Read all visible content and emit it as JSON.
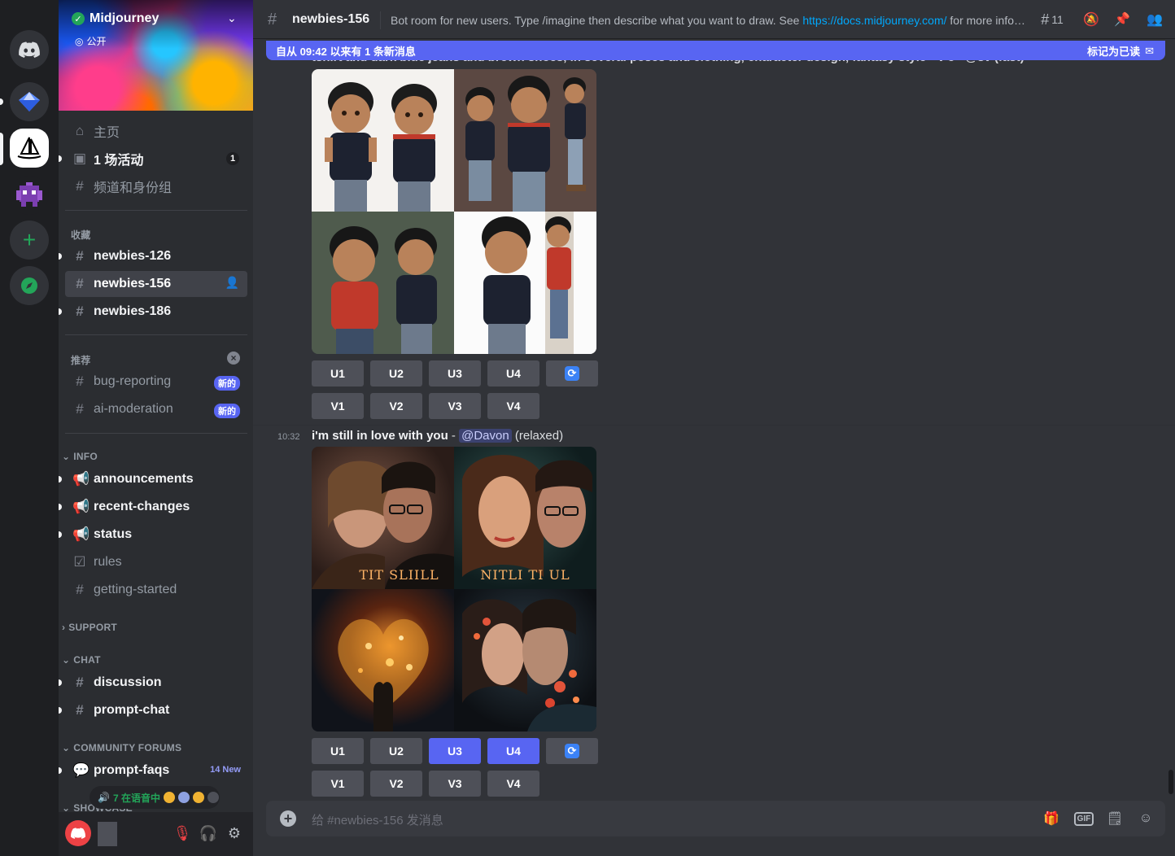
{
  "server": {
    "name": "Midjourney",
    "visibility": "公开"
  },
  "nav": {
    "home": "主页",
    "events": "1 场活动",
    "events_count": "1",
    "channels_roles": "频道和身份组"
  },
  "sections": {
    "favorites": "收藏",
    "recommended": "推荐",
    "info": "INFO",
    "support": "SUPPORT",
    "chat": "CHAT",
    "community": "COMMUNITY FORUMS",
    "showcase": "SHOWCASE"
  },
  "channels": {
    "fav": [
      "newbies-126",
      "newbies-156",
      "newbies-186"
    ],
    "rec": [
      {
        "name": "bug-reporting",
        "tag": "新的"
      },
      {
        "name": "ai-moderation",
        "tag": "新的"
      }
    ],
    "info": [
      "announcements",
      "recent-changes",
      "status",
      "rules",
      "getting-started"
    ],
    "chat": [
      "discussion",
      "prompt-chat"
    ],
    "forum": {
      "name": "prompt-faqs",
      "count": "14 New"
    }
  },
  "voice": {
    "label": "7 在语音中"
  },
  "header": {
    "channel": "newbies-156",
    "topic_before": "Bot room for new users. Type /imagine then describe what you want to draw. See ",
    "topic_link": "https://docs.midjourney.com/",
    "topic_after": " for more informa...",
    "thread_count": "11"
  },
  "newbar": {
    "text": "自从 09:42 以来有 1 条新消息",
    "mark": "标记为已读"
  },
  "prev_message": {
    "text": "tshirt and dark blue jeans and brown shoes, in several poses and clothing, character design, fantasy style --v 5 - @sv (fast)"
  },
  "message": {
    "time": "10:32",
    "prompt": "i'm still in love with you",
    "sep": " - ",
    "mention": "@Davon",
    "mode": " (relaxed)",
    "captions": [
      "TIT SLIILL",
      "NITLI TI UL"
    ]
  },
  "buttons": {
    "u": [
      "U1",
      "U2",
      "U3",
      "U4"
    ],
    "v": [
      "V1",
      "V2",
      "V3",
      "V4"
    ]
  },
  "composer": {
    "placeholder": "给 #newbies-156 发消息",
    "gif": "GIF"
  }
}
